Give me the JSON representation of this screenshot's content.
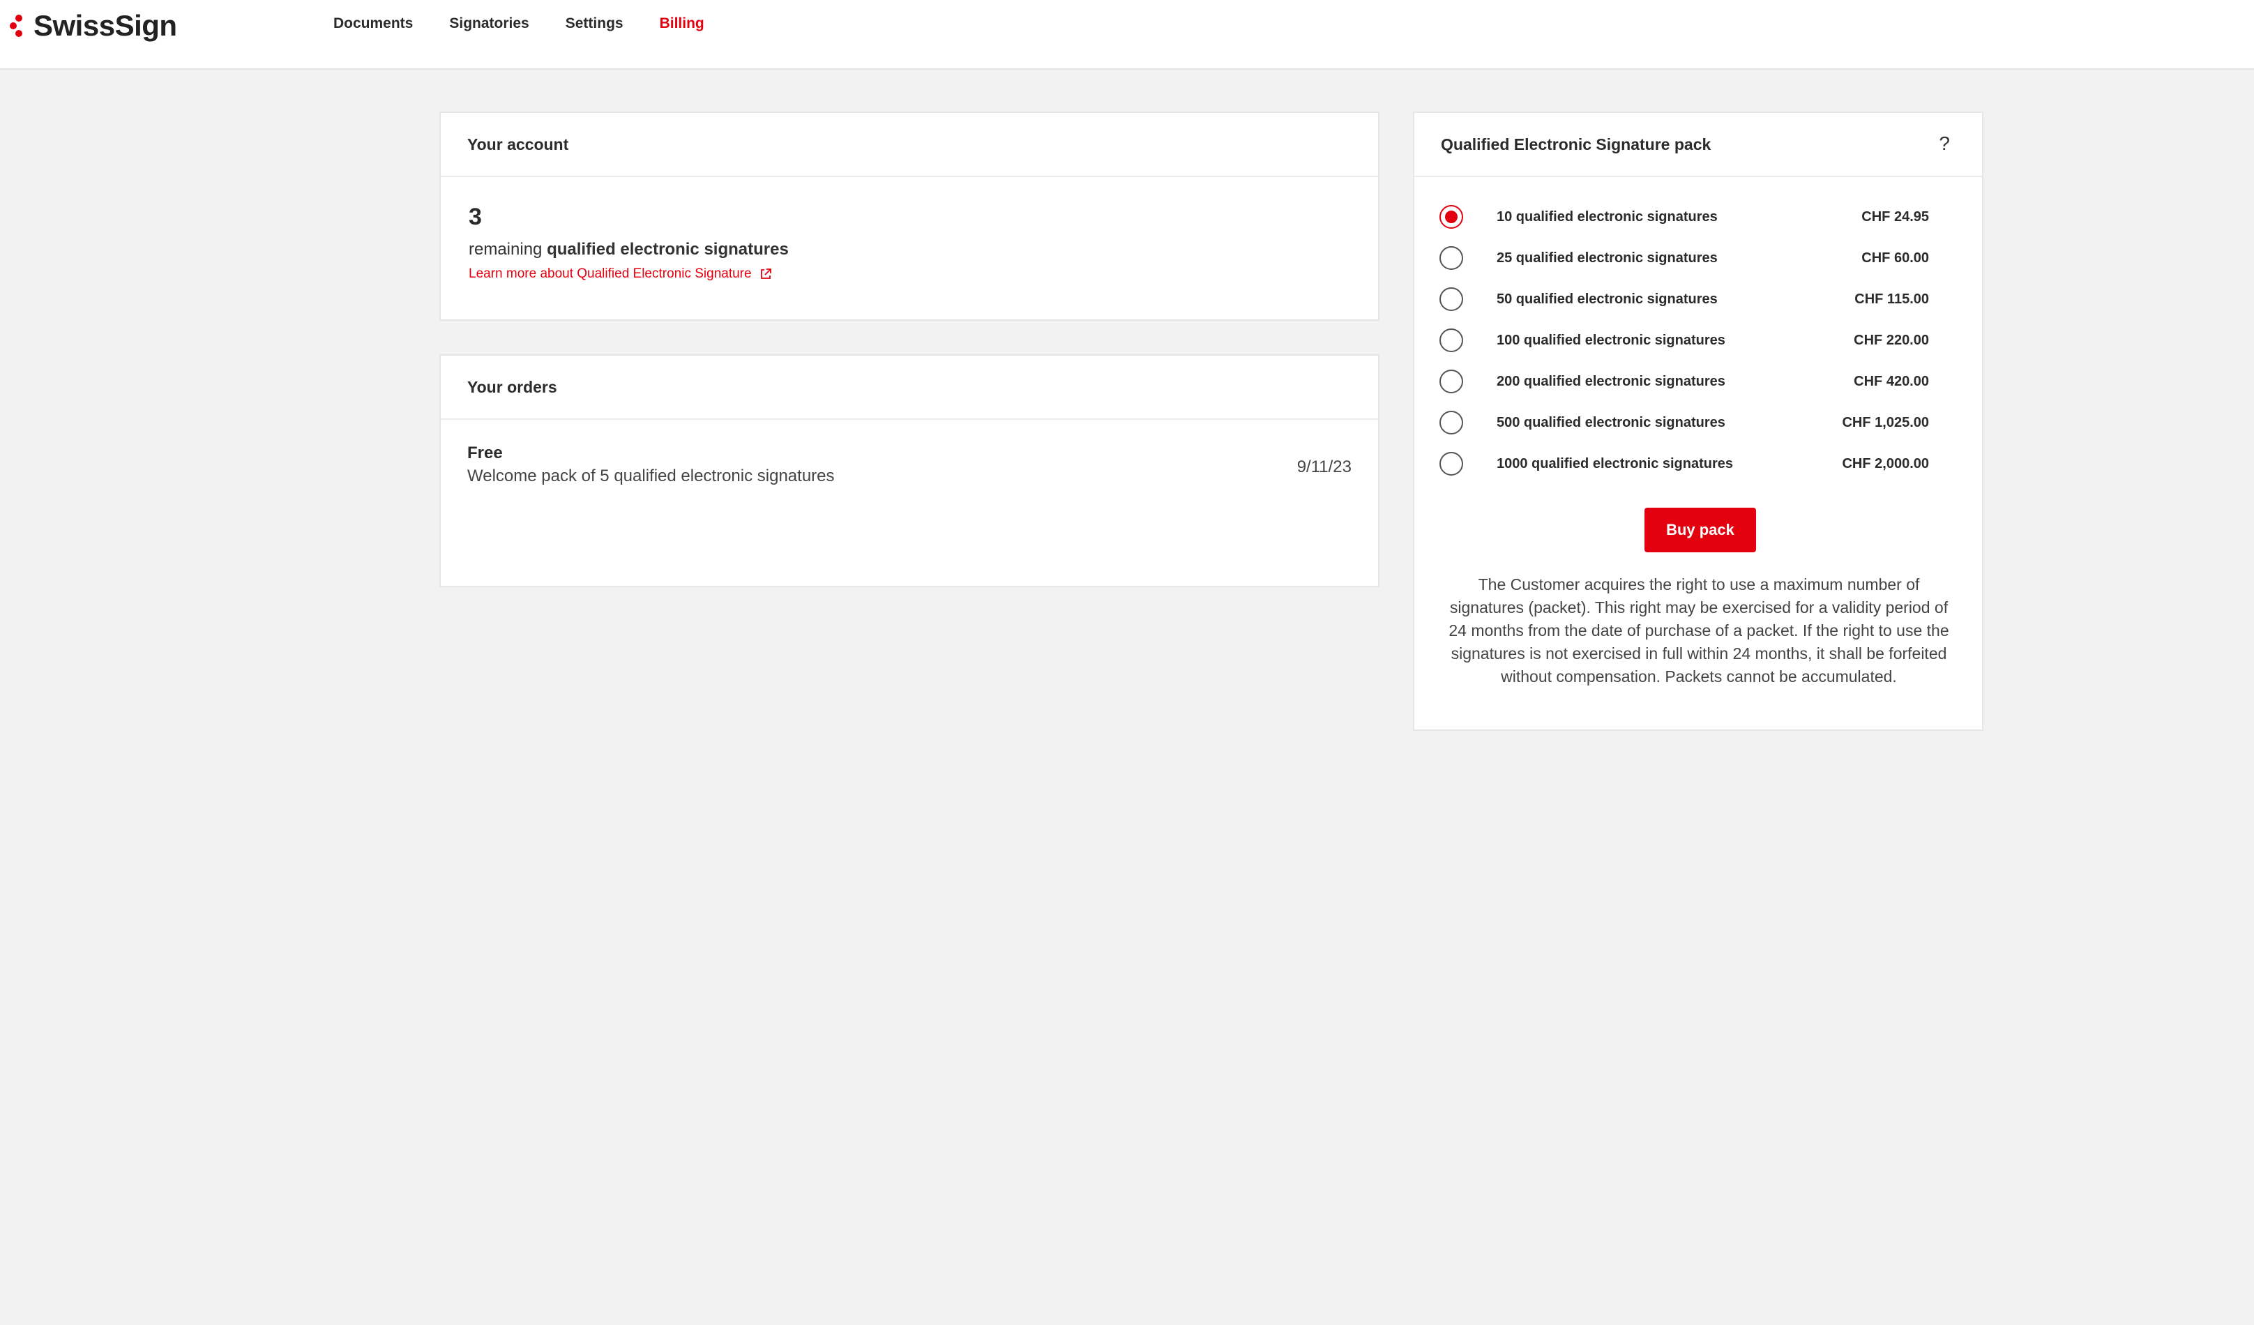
{
  "brand": {
    "name": "SwissSign",
    "accent_color": "#e3000f"
  },
  "nav": {
    "items": [
      {
        "label": "Documents",
        "active": false
      },
      {
        "label": "Signatories",
        "active": false
      },
      {
        "label": "Settings",
        "active": false
      },
      {
        "label": "Billing",
        "active": true
      }
    ]
  },
  "account": {
    "title": "Your account",
    "remaining_count": "3",
    "remaining_prefix": "remaining",
    "remaining_bold": "qualified electronic signatures",
    "learn_more_link": "Learn more about Qualified Electronic Signature",
    "link_icon": "external-link-icon"
  },
  "orders": {
    "title": "Your orders",
    "items": [
      {
        "title": "Free",
        "description": "Welcome pack of 5 qualified electronic signatures",
        "date": "9/11/23"
      }
    ]
  },
  "pack": {
    "title": "Qualified Electronic Signature pack",
    "help_label": "?",
    "options": [
      {
        "label": "10 qualified electronic signatures",
        "price": "CHF 24.95",
        "selected": true
      },
      {
        "label": "25 qualified electronic signatures",
        "price": "CHF 60.00",
        "selected": false
      },
      {
        "label": "50 qualified electronic signatures",
        "price": "CHF 115.00",
        "selected": false
      },
      {
        "label": "100 qualified electronic signatures",
        "price": "CHF 220.00",
        "selected": false
      },
      {
        "label": "200 qualified electronic signatures",
        "price": "CHF 420.00",
        "selected": false
      },
      {
        "label": "500 qualified electronic signatures",
        "price": "CHF 1,025.00",
        "selected": false
      },
      {
        "label": "1000 qualified electronic signatures",
        "price": "CHF 2,000.00",
        "selected": false
      }
    ],
    "buy_label": "Buy pack",
    "terms": "The Customer acquires the right to use a maximum number of signatures (packet). This right may be exercised for a validity period of 24 months from the date of purchase of a packet. If the right to use the signatures is not exercised in full within 24 months, it shall be forfeited without compensation. Packets cannot be accumulated."
  }
}
